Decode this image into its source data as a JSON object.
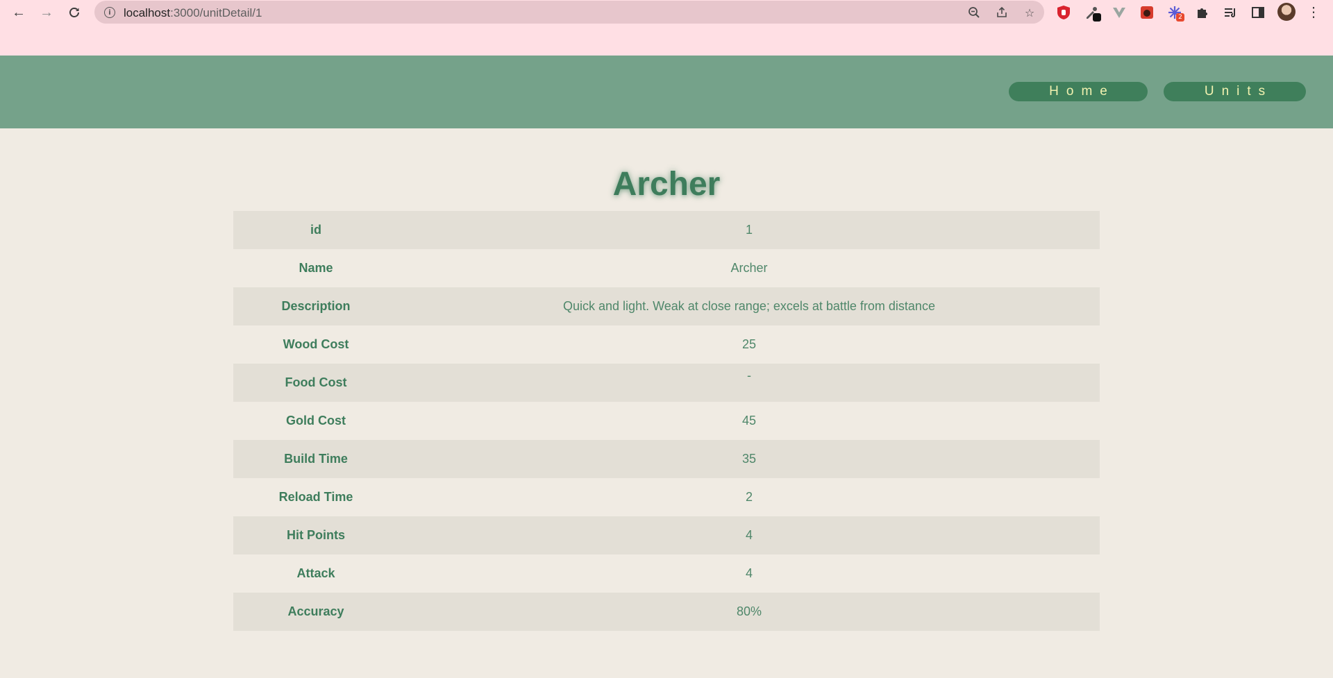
{
  "browser": {
    "url_host": "localhost",
    "url_rest": ":3000/unitDetail/1",
    "extensions": [
      {
        "name": "ublock-icon",
        "color": "#d9232e"
      },
      {
        "name": "eyedropper-icon",
        "color": "#555555"
      },
      {
        "name": "vue-devtools-icon",
        "color": "#9aa6a0"
      },
      {
        "name": "bug-icon",
        "color": "#d63b2c"
      },
      {
        "name": "sparkle-extension-icon",
        "color": "#5b5bd6",
        "badge": "2"
      },
      {
        "name": "puzzle-icon",
        "color": "#333333"
      },
      {
        "name": "reading-list-icon",
        "color": "#333333"
      },
      {
        "name": "side-panel-icon",
        "color": "#333333"
      }
    ]
  },
  "site": {
    "nav": {
      "home_label": "Home",
      "units_label": "Units"
    }
  },
  "unit": {
    "title": "Archer",
    "rows": [
      {
        "label": "id",
        "value": "1"
      },
      {
        "label": "Name",
        "value": "Archer"
      },
      {
        "label": "Description",
        "value": "Quick and light. Weak at close range; excels at battle from distance"
      },
      {
        "label": "Wood Cost",
        "value": "25"
      },
      {
        "label": "Food Cost",
        "value": "-"
      },
      {
        "label": "Gold Cost",
        "value": "45"
      },
      {
        "label": "Build Time",
        "value": "35"
      },
      {
        "label": "Reload Time",
        "value": "2"
      },
      {
        "label": "Hit Points",
        "value": "4"
      },
      {
        "label": "Attack",
        "value": "4"
      },
      {
        "label": "Accuracy",
        "value": "80%"
      }
    ]
  },
  "colors": {
    "chrome_bg": "#ffdfe4",
    "header_bg": "#75a28a",
    "nav_button_bg": "#3f7f5b",
    "nav_button_text": "#f2f2b0",
    "page_bg": "#f0ebe3",
    "row_alt_bg": "#e3dfd6",
    "accent_text": "#3e7d5c"
  }
}
